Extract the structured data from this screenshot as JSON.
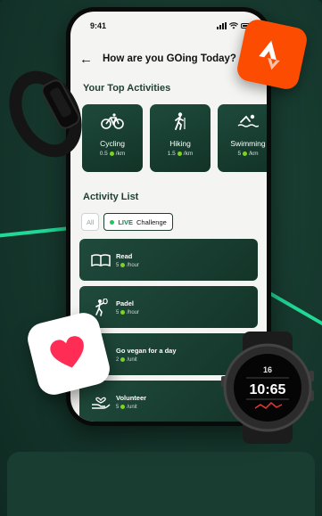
{
  "status_bar": {
    "time": "9:41"
  },
  "header": {
    "title": "How are you GOing Today?"
  },
  "top_activities": {
    "title": "Your Top Activities",
    "cards": [
      {
        "name": "Cycling",
        "rate_value": "0.5",
        "rate_unit": "/km",
        "icon": "bicycle-icon"
      },
      {
        "name": "Hiking",
        "rate_value": "1.5",
        "rate_unit": "/km",
        "icon": "hiker-icon"
      },
      {
        "name": "Swimming",
        "rate_value": "5",
        "rate_unit": "/km",
        "icon": "swimmer-icon"
      }
    ]
  },
  "activity_list": {
    "title": "Activity List",
    "filters": {
      "all": "All",
      "live": "LIVE",
      "challenge": "Challenge"
    },
    "items": [
      {
        "name": "Read",
        "rate_value": "5",
        "rate_unit": "/hour",
        "icon": "book-icon"
      },
      {
        "name": "Padel",
        "rate_value": "5",
        "rate_unit": "/hour",
        "icon": "padel-player-icon"
      },
      {
        "name": "Go vegan for a day",
        "rate_value": "2",
        "rate_unit": "/unit",
        "icon": "leaf-icon"
      },
      {
        "name": "Volunteer",
        "rate_value": "5",
        "rate_unit": "/unit",
        "icon": "volunteer-hands-icon"
      }
    ]
  },
  "garmin_watch": {
    "time": "10:65",
    "top_value": "16"
  },
  "colors": {
    "background": "#173a2f",
    "accent_green": "#20d996",
    "card_green": "#1e4a3b",
    "strava_orange": "#fc4c02",
    "health_heart": "#ff2d55",
    "coin": "#7ed321"
  }
}
